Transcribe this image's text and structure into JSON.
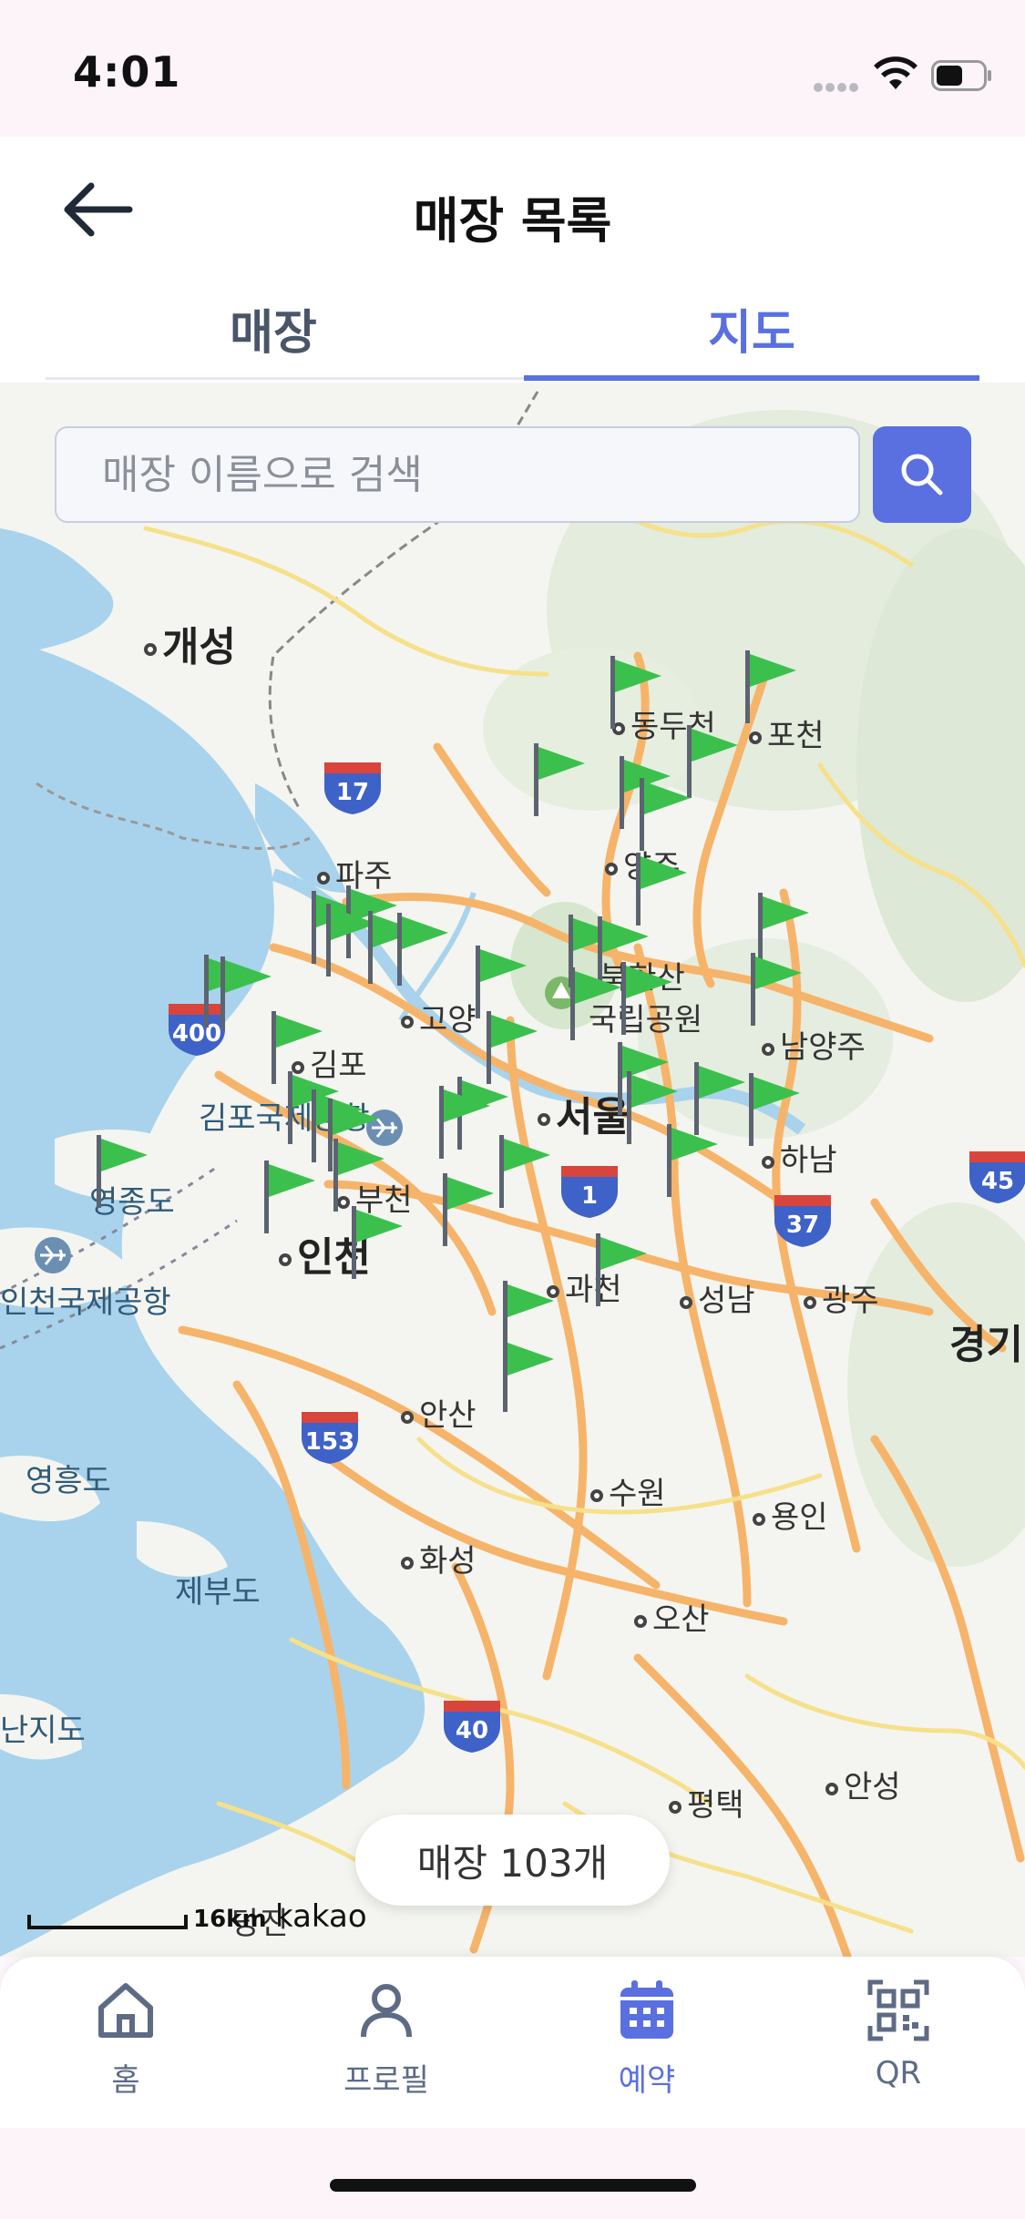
{
  "status_bar": {
    "time": "4:01"
  },
  "header": {
    "title": "매장 목록"
  },
  "tabs": [
    {
      "label": "매장",
      "active": false
    },
    {
      "label": "지도",
      "active": true
    }
  ],
  "search": {
    "placeholder": "매장 이름으로 검색"
  },
  "map": {
    "place_labels": {
      "gaeseong": "개성",
      "dongducheon": "동두천",
      "pocheon": "포천",
      "paju": "파주",
      "yangju": "양주",
      "goyang": "고양",
      "gimpo": "김포",
      "bukhansan": "북한산",
      "national_park": "국립공원",
      "namyangju": "남양주",
      "gimpo_airport": "김포국제공항",
      "seoul": "서울",
      "hanam": "하남",
      "yeongjongdo": "영종도",
      "bucheon": "부천",
      "incheon": "인천",
      "incheon_airport": "인천국제공항",
      "gwacheon": "과천",
      "seongnam": "성남",
      "gwangju": "광주",
      "gyeonggi": "경기",
      "ansan": "안산",
      "yeongheungdo": "영흥도",
      "suwon": "수원",
      "yongin": "용인",
      "jebudo": "제부도",
      "hwaseong": "화성",
      "osan": "오산",
      "daebudo": "난지도",
      "anseong": "안성",
      "pyeongtaek": "평택",
      "dangjin": "당진"
    },
    "route_shields": [
      "17",
      "400",
      "1",
      "37",
      "45",
      "153",
      "40"
    ],
    "store_count_label": "매장 103개",
    "scale_label": "16km",
    "attribution": "kakao",
    "flag_color": "#3cc04d"
  },
  "bottom_nav": [
    {
      "label": "홈",
      "icon": "home-icon",
      "active": false
    },
    {
      "label": "프로필",
      "icon": "profile-icon",
      "active": false
    },
    {
      "label": "예약",
      "icon": "calendar-icon",
      "active": true
    },
    {
      "label": "QR",
      "icon": "qr-icon",
      "active": false
    }
  ],
  "colors": {
    "accent": "#5a6fe0",
    "inactive": "#5d6b85"
  }
}
